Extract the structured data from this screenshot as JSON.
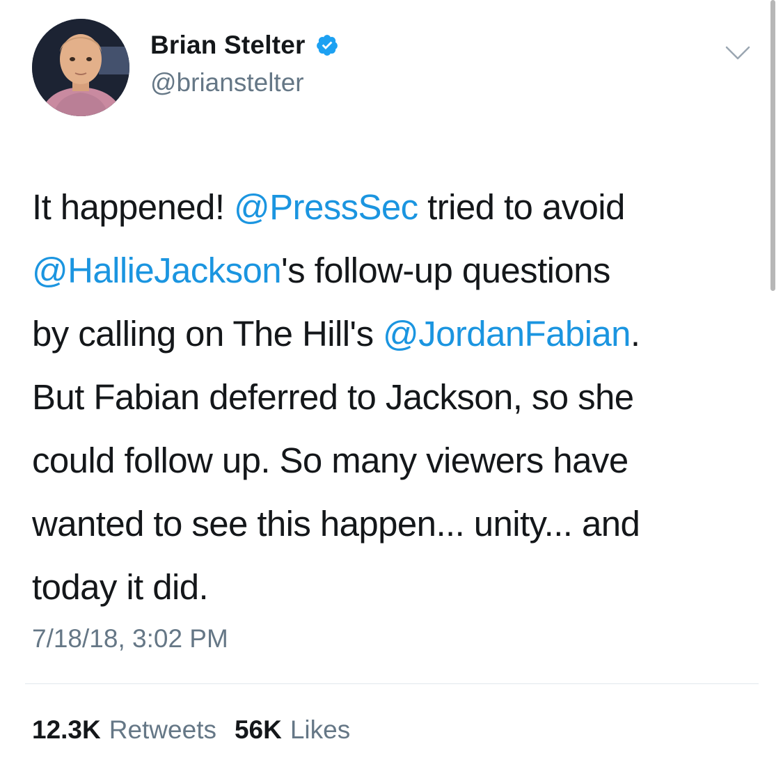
{
  "user": {
    "display_name": "Brian Stelter",
    "handle": "@brianstelter",
    "verified": true
  },
  "tweet": {
    "lines": [
      [
        {
          "text": "It happened! ",
          "mention": false
        },
        {
          "text": "@PressSec",
          "mention": true
        },
        {
          "text": " tried to avoid",
          "mention": false
        }
      ],
      [
        {
          "text": "@HallieJackson",
          "mention": true
        },
        {
          "text": "'s follow-up questions",
          "mention": false
        }
      ],
      [
        {
          "text": "by calling on The Hill's ",
          "mention": false
        },
        {
          "text": "@JordanFabian",
          "mention": true
        },
        {
          "text": ".",
          "mention": false
        }
      ],
      [
        {
          "text": "But Fabian deferred to Jackson, so she",
          "mention": false
        }
      ],
      [
        {
          "text": "could follow up. So many viewers have",
          "mention": false
        }
      ],
      [
        {
          "text": "wanted to see this happen... unity... and",
          "mention": false
        }
      ],
      [
        {
          "text": "today it did.",
          "mention": false
        }
      ]
    ],
    "timestamp": "7/18/18, 3:02 PM"
  },
  "stats": {
    "retweets_count": "12.3K",
    "retweets_label": "Retweets",
    "likes_count": "56K",
    "likes_label": "Likes"
  },
  "icons": {
    "verified": "verified-badge-icon",
    "caret": "chevron-down-icon"
  },
  "colors": {
    "mention": "#1b95e0",
    "secondary_text": "#657786",
    "verified": "#1da1f2"
  }
}
